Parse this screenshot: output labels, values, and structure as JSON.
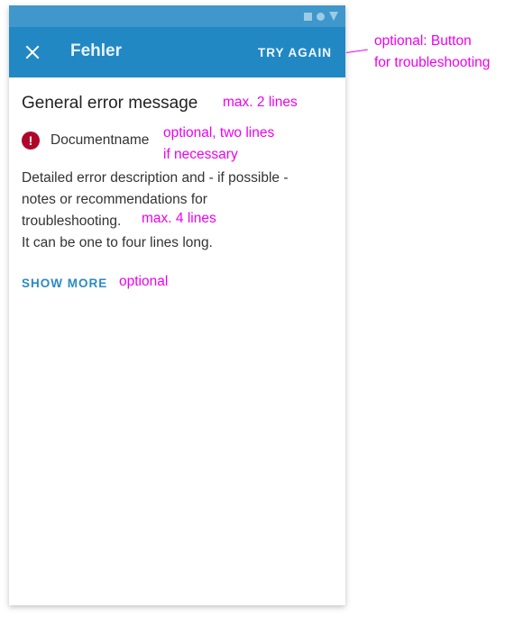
{
  "status_bar": {
    "icons": [
      "square-icon",
      "circle-icon",
      "triangle-icon"
    ]
  },
  "app_bar": {
    "close_icon": "close-icon",
    "title": "Fehler",
    "action_label": "TRY AGAIN"
  },
  "content": {
    "headline": "General error message",
    "error_icon": "error-exclamation-icon",
    "error_icon_glyph": "!",
    "document_name": "Documentname",
    "description_lines": [
      "Detailed error description and - if possible -",
      "notes or recommendations for",
      "troubleshooting."
    ],
    "description_extra": "It can be one to four lines long.",
    "show_more_label": "SHOW MORE"
  },
  "annotations": {
    "try_again": [
      "optional: Button",
      "for troubleshooting"
    ],
    "headline": "max. 2 lines",
    "document": [
      "optional, two lines",
      "if necessary"
    ],
    "description": "max. 4 lines",
    "show_more": "optional"
  },
  "colors": {
    "status_bar": "#3f97cb",
    "app_bar": "#2188c4",
    "error": "#b0062a",
    "accent": "#2a8bc6",
    "annotation": "#ee00ee"
  }
}
